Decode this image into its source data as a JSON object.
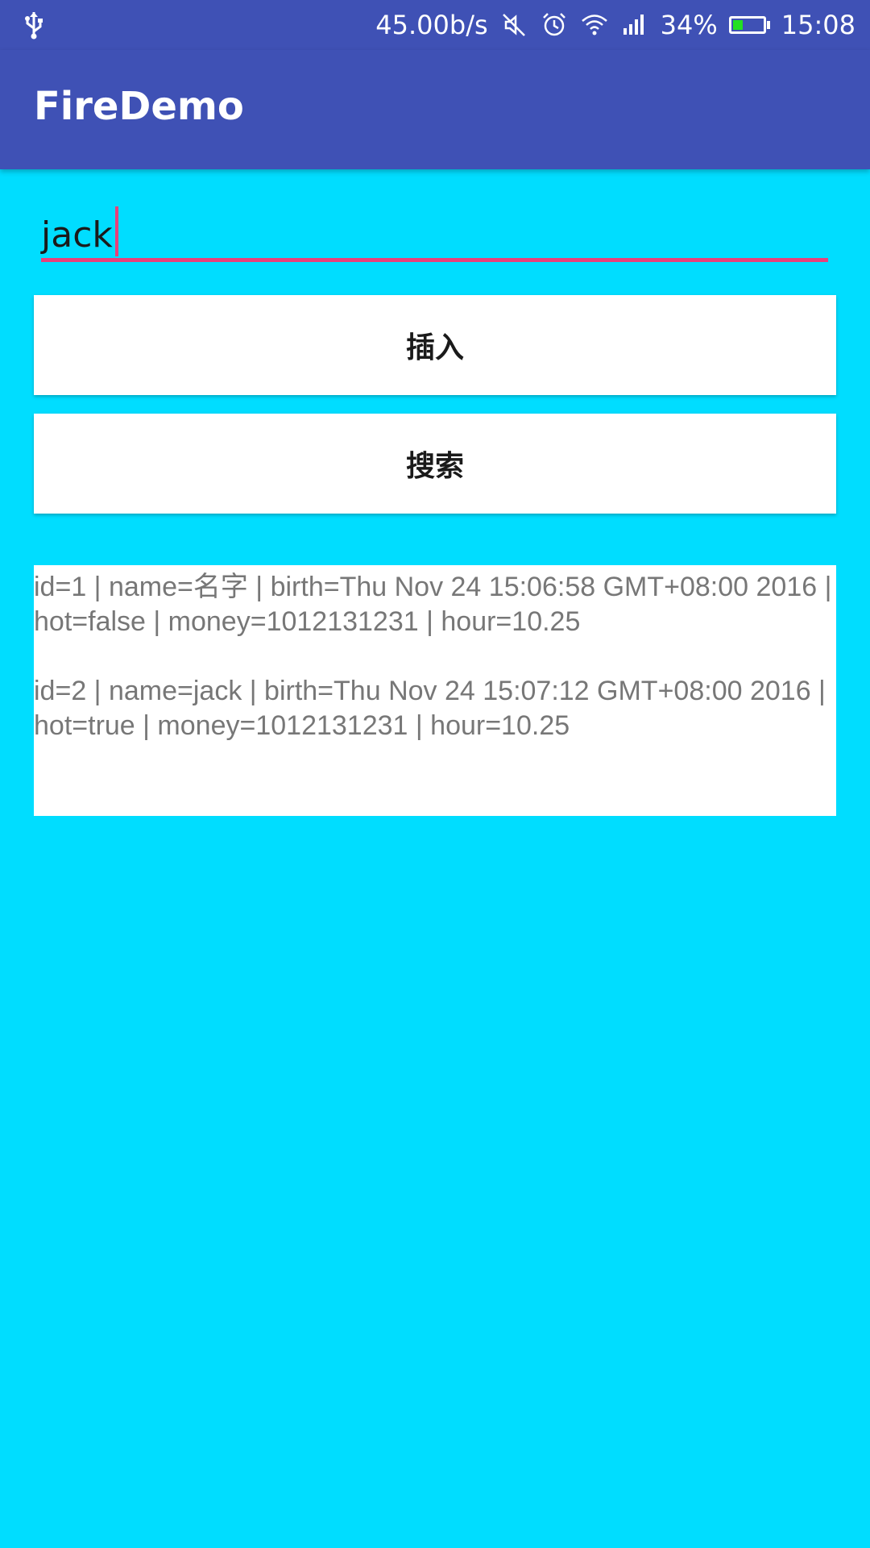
{
  "status_bar": {
    "usb_icon": "usb-icon",
    "network_speed": "45.00b/s",
    "icons": [
      "mute-icon",
      "alarm-icon",
      "wifi-icon",
      "signal-icon"
    ],
    "battery_percent": "34%",
    "battery_level": 0.34,
    "battery_color": "#22E022",
    "time": "15:08"
  },
  "app_bar": {
    "title": "FireDemo",
    "color": "#3F51B5"
  },
  "input": {
    "value": "jack",
    "accent_color": "#E8407A"
  },
  "buttons": {
    "insert_label": "插入",
    "search_label": "搜索"
  },
  "results": [
    "id=1 | name=名字 | birth=Thu Nov 24 15:06:58 GMT+08:00 2016 | hot=false | money=1012131231 | hour=10.25",
    "id=2 | name=jack | birth=Thu Nov 24 15:07:12 GMT+08:00 2016 | hot=true | money=1012131231 | hour=10.25"
  ],
  "background_color": "#00DDFF"
}
